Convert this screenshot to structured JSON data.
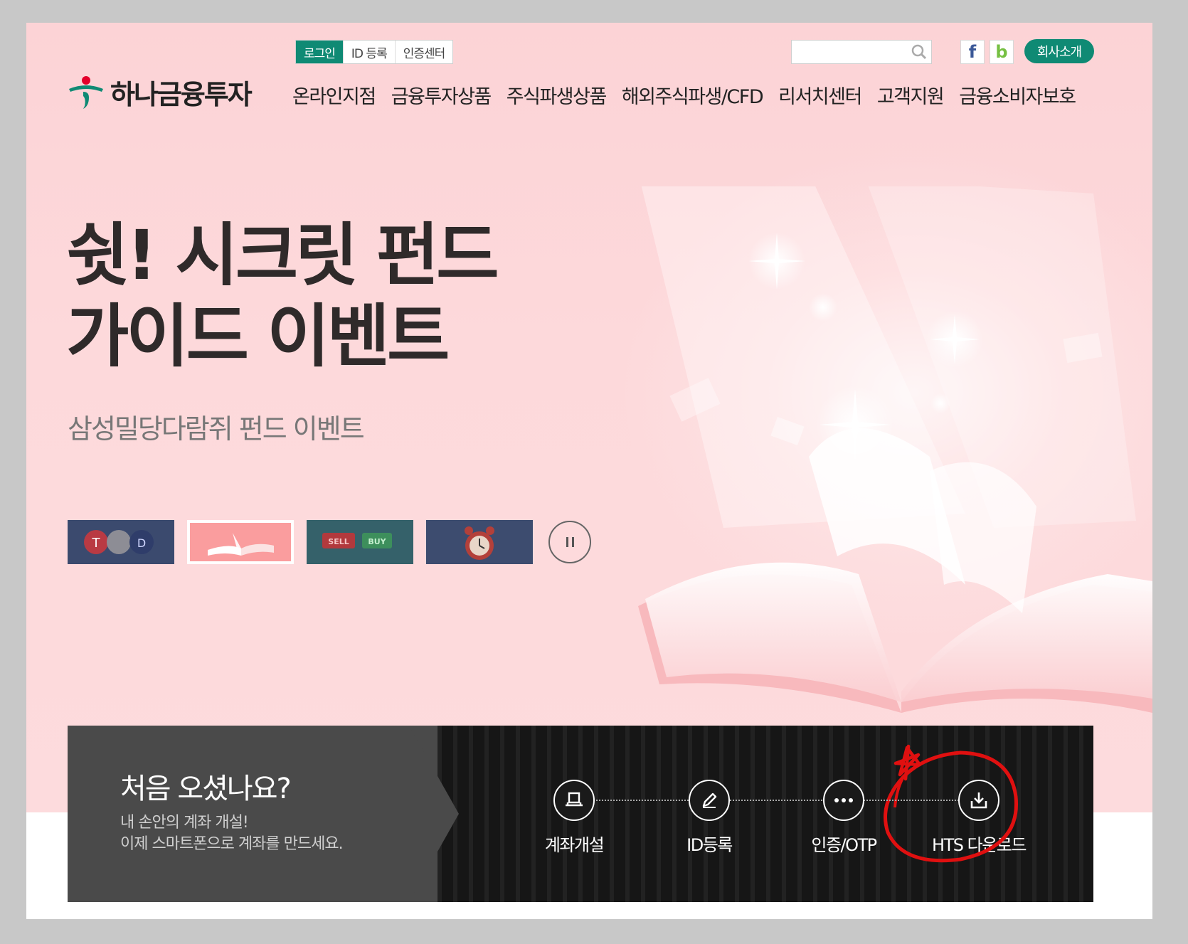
{
  "header": {
    "logo_text": "하나금융투자",
    "util_links": [
      "로그인",
      "ID 등록",
      "인증센터"
    ],
    "search_placeholder": "",
    "sns": {
      "facebook": "f",
      "blog": "b"
    },
    "company_button": "회사소개",
    "gnb": [
      "온라인지점",
      "금융투자상품",
      "주식파생상품",
      "해외주식파생/CFD",
      "리서치센터",
      "고객지원",
      "금융소비자보호"
    ]
  },
  "hero": {
    "headline_line1": "쉿! 시크릿 펀드",
    "headline_line2": "가이드 이벤트",
    "subline": "삼성밀당다람쥐 펀드 이벤트",
    "thumbnails": [
      {
        "name": "thumb-stocks",
        "labels": [
          "T",
          "",
          "D"
        ]
      },
      {
        "name": "thumb-book",
        "labels": []
      },
      {
        "name": "thumb-sell-buy",
        "labels": [
          "SELL",
          "BUY"
        ]
      },
      {
        "name": "thumb-clock",
        "labels": []
      }
    ],
    "active_thumb": 2
  },
  "quick": {
    "title": "처음 오셨나요?",
    "desc_line1": "내 손안의 계좌 개설!",
    "desc_line2": "이제 스마트폰으로 계좌를 만드세요.",
    "items": [
      {
        "label": "계좌개설",
        "icon": "account-open-icon"
      },
      {
        "label": "ID등록",
        "icon": "pencil-icon"
      },
      {
        "label": "인증/OTP",
        "icon": "password-dots-icon"
      },
      {
        "label": "HTS 다운로드",
        "icon": "download-icon"
      }
    ]
  },
  "colors": {
    "brand_green": "#0f8a74",
    "hero_pink": "#fdd9db",
    "annotation_red": "#e01010"
  }
}
